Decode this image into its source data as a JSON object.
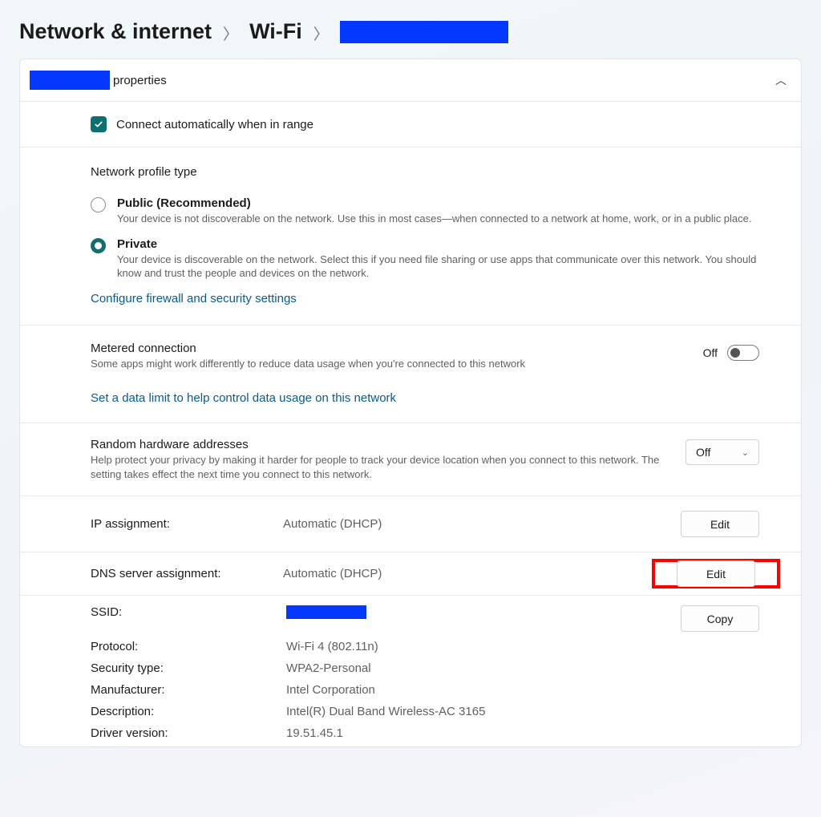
{
  "breadcrumb": {
    "level1": "Network & internet",
    "level2": "Wi-Fi"
  },
  "properties_header_suffix": "properties",
  "auto_connect": {
    "label": "Connect automatically when in range",
    "checked": true
  },
  "profile_type": {
    "title": "Network profile type",
    "options": [
      {
        "label": "Public (Recommended)",
        "desc": "Your device is not discoverable on the network. Use this in most cases—when connected to a network at home, work, or in a public place.",
        "selected": false
      },
      {
        "label": "Private",
        "desc": "Your device is discoverable on the network. Select this if you need file sharing or use apps that communicate over this network. You should know and trust the people and devices on the network.",
        "selected": true
      }
    ],
    "firewall_link": "Configure firewall and security settings"
  },
  "metered": {
    "title": "Metered connection",
    "desc": "Some apps might work differently to reduce data usage when you're connected to this network",
    "state_label": "Off",
    "link": "Set a data limit to help control data usage on this network"
  },
  "random_mac": {
    "title": "Random hardware addresses",
    "desc": "Help protect your privacy by making it harder for people to track your device location when you connect to this network. The setting takes effect the next time you connect to this network.",
    "dropdown_value": "Off"
  },
  "ip_assignment": {
    "label": "IP assignment:",
    "value": "Automatic (DHCP)",
    "button": "Edit"
  },
  "dns_assignment": {
    "label": "DNS server assignment:",
    "value": "Automatic (DHCP)",
    "button": "Edit"
  },
  "copy_button": "Copy",
  "details": [
    {
      "k": "SSID:",
      "v": ""
    },
    {
      "k": "Protocol:",
      "v": "Wi-Fi 4 (802.11n)"
    },
    {
      "k": "Security type:",
      "v": "WPA2-Personal"
    },
    {
      "k": "Manufacturer:",
      "v": "Intel Corporation"
    },
    {
      "k": "Description:",
      "v": "Intel(R) Dual Band Wireless-AC 3165"
    },
    {
      "k": "Driver version:",
      "v": "19.51.45.1"
    }
  ]
}
